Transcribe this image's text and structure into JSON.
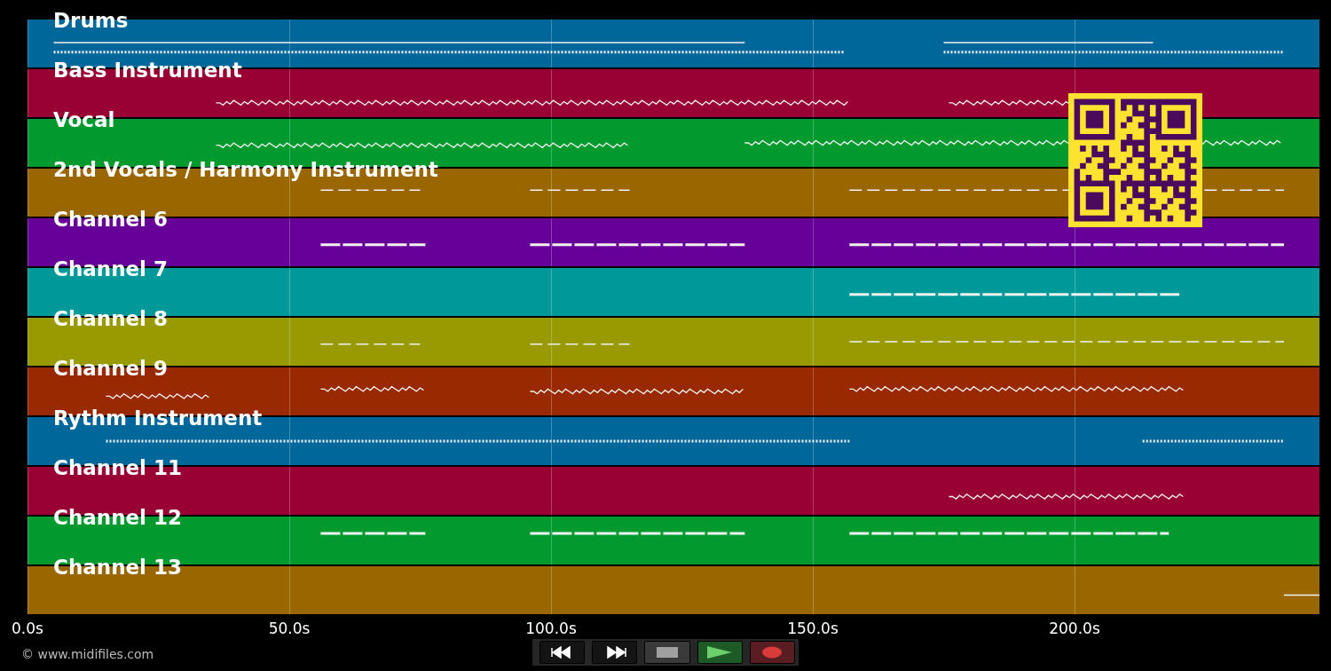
{
  "tracks": [
    {
      "name": "Drums",
      "color": "#00679a"
    },
    {
      "name": "Bass Instrument",
      "color": "#990033"
    },
    {
      "name": "Vocal",
      "color": "#009a2e"
    },
    {
      "name": "2nd Vocals / Harmony Instrument",
      "color": "#996600"
    },
    {
      "name": "Channel 6",
      "color": "#660099"
    },
    {
      "name": "Channel 7",
      "color": "#009999"
    },
    {
      "name": "Channel 8",
      "color": "#999900"
    },
    {
      "name": "Channel 9",
      "color": "#992900"
    },
    {
      "name": "Rythm Instrument",
      "color": "#00679a"
    },
    {
      "name": "Channel 11",
      "color": "#990033"
    },
    {
      "name": "Channel 12",
      "color": "#009a2e"
    },
    {
      "name": "Channel 13",
      "color": "#996600"
    }
  ],
  "time_axis": {
    "ticks": [
      "0.0s",
      "50.0s",
      "100.0s",
      "150.0s",
      "200.0s"
    ]
  },
  "transport": {
    "buttons": [
      {
        "kind": "rewind"
      },
      {
        "kind": "forward"
      },
      {
        "kind": "stop"
      },
      {
        "kind": "play"
      },
      {
        "kind": "record"
      }
    ]
  },
  "copyright": "© www.midifiles.com"
}
